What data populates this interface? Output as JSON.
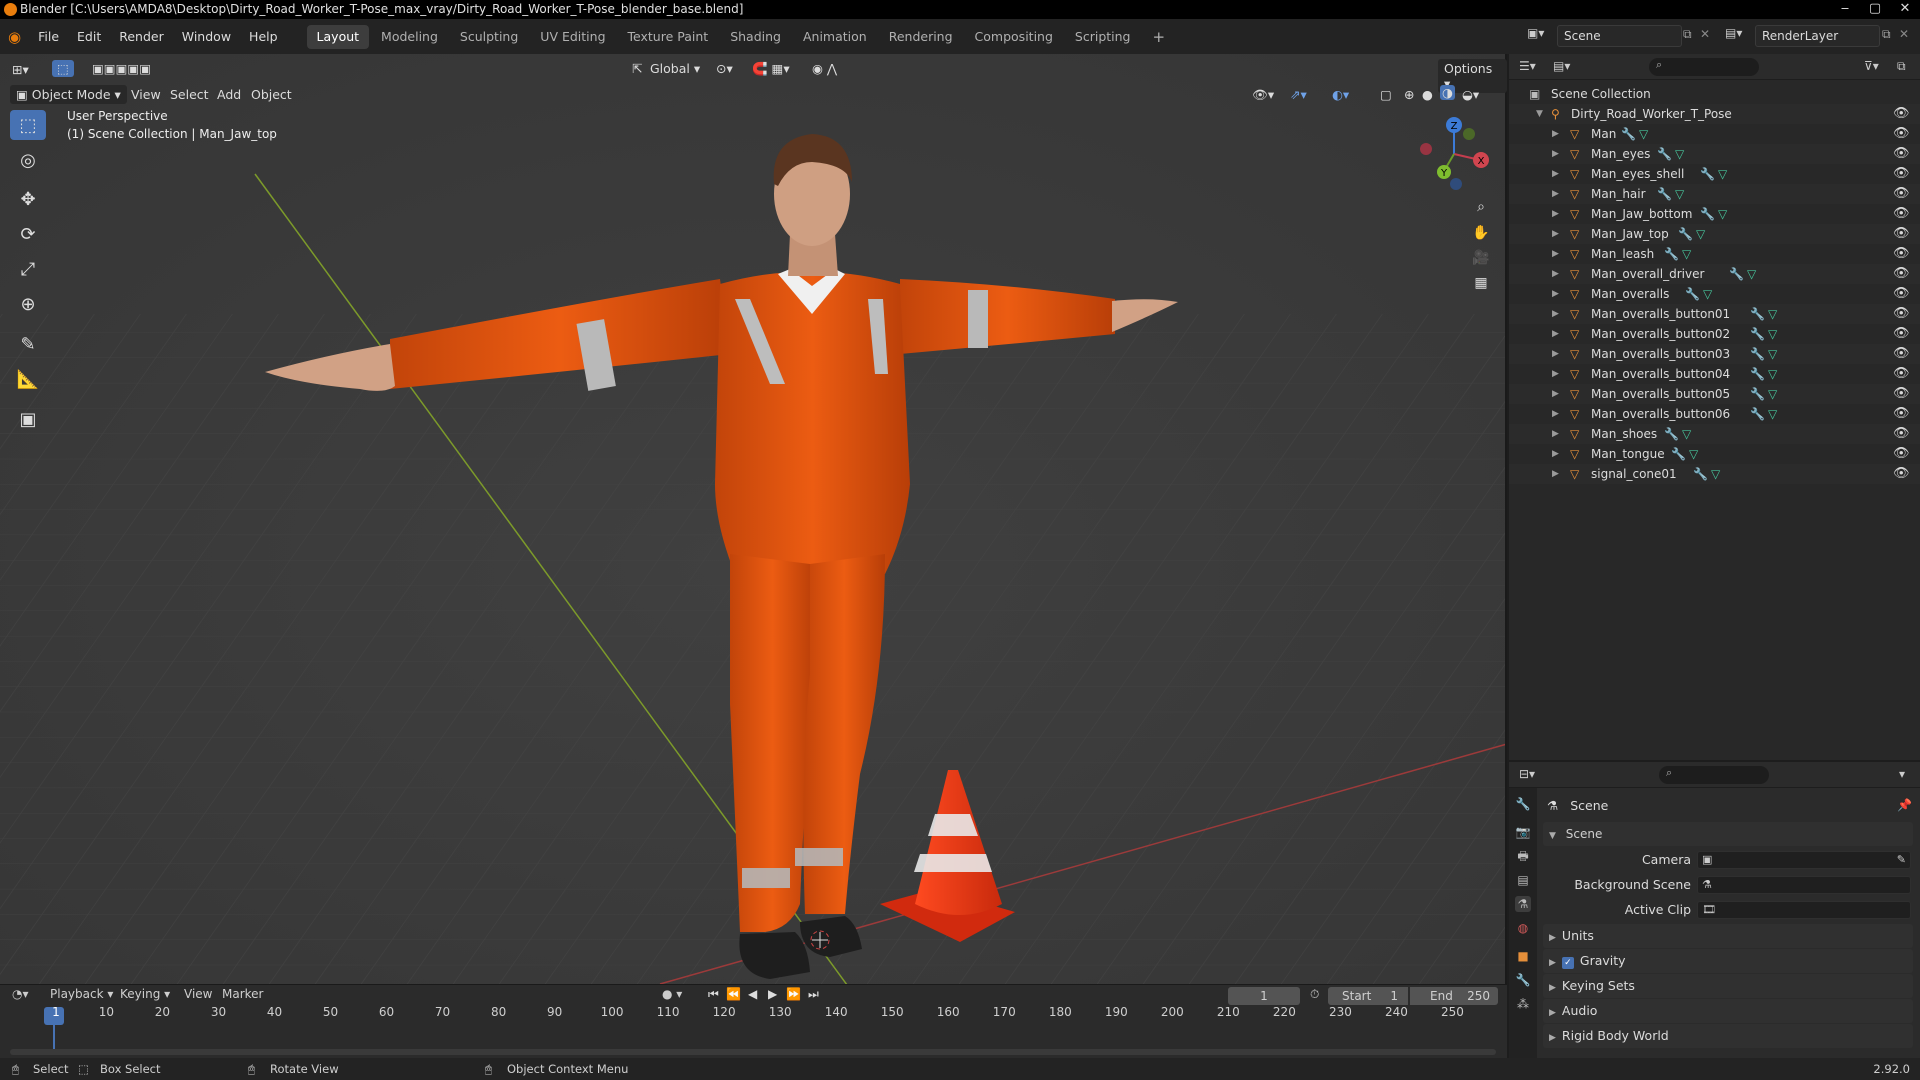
{
  "window": {
    "title": "Blender [C:\\Users\\AMDA8\\Desktop\\Dirty_Road_Worker_T-Pose_max_vray/Dirty_Road_Worker_T-Pose_blender_base.blend]",
    "controls": [
      "‒",
      "▢",
      "✕"
    ]
  },
  "menu": [
    "File",
    "Edit",
    "Render",
    "Window",
    "Help"
  ],
  "workspaces": [
    {
      "label": "Layout",
      "active": true
    },
    {
      "label": "Modeling"
    },
    {
      "label": "Sculpting"
    },
    {
      "label": "UV Editing"
    },
    {
      "label": "Texture Paint"
    },
    {
      "label": "Shading"
    },
    {
      "label": "Animation"
    },
    {
      "label": "Rendering"
    },
    {
      "label": "Compositing"
    },
    {
      "label": "Scripting"
    }
  ],
  "scene": {
    "name": "Scene",
    "render_layer": "RenderLayer"
  },
  "viewport": {
    "orientation": "Global",
    "options_label": "Options",
    "mode": "Object Mode",
    "menus": [
      "View",
      "Select",
      "Add",
      "Object"
    ],
    "info_line1": "User Perspective",
    "info_line2": "(1) Scene Collection | Man_Jaw_top",
    "gizmo": {
      "x": "X",
      "y": "Y",
      "z": "Z"
    }
  },
  "outliner": {
    "root": "Scene Collection",
    "collection": "Dirty_Road_Worker_T_Pose",
    "objects": [
      "Man",
      "Man_eyes",
      "Man_eyes_shell",
      "Man_hair",
      "Man_Jaw_bottom",
      "Man_Jaw_top",
      "Man_leash",
      "Man_overall_driver",
      "Man_overalls",
      "Man_overalls_button01",
      "Man_overalls_button02",
      "Man_overalls_button03",
      "Man_overalls_button04",
      "Man_overalls_button05",
      "Man_overalls_button06",
      "Man_shoes",
      "Man_tongue",
      "signal_cone01"
    ]
  },
  "properties": {
    "breadcrumb": "Scene",
    "panel": "Scene",
    "fields": [
      {
        "label": "Camera"
      },
      {
        "label": "Background Scene"
      },
      {
        "label": "Active Clip"
      }
    ],
    "subpanels": [
      {
        "label": "Units",
        "checkbox": false
      },
      {
        "label": "Gravity",
        "checkbox": true
      },
      {
        "label": "Keying Sets",
        "checkbox": false
      },
      {
        "label": "Audio",
        "checkbox": false
      },
      {
        "label": "Rigid Body World",
        "checkbox": false
      }
    ]
  },
  "timeline": {
    "menus": [
      "Playback",
      "Keying",
      "View",
      "Marker"
    ],
    "current_frame": "1",
    "start_label": "Start",
    "start": "1",
    "end_label": "End",
    "end": "250",
    "ticks": [
      "1",
      "10",
      "20",
      "30",
      "40",
      "50",
      "60",
      "70",
      "80",
      "90",
      "100",
      "110",
      "120",
      "130",
      "140",
      "150",
      "160",
      "170",
      "180",
      "190",
      "200",
      "210",
      "220",
      "230",
      "240",
      "250"
    ]
  },
  "status": {
    "select": "Select",
    "box_select": "Box Select",
    "rotate_view": "Rotate View",
    "context_menu": "Object Context Menu",
    "version": "2.92.0"
  },
  "colors": {
    "accent": "#4772b3",
    "object_orange": "#e58f3a",
    "mesh_green": "#47c39a",
    "wrench_blue": "#6fa2e8",
    "suit_orange": "#e8570f"
  }
}
